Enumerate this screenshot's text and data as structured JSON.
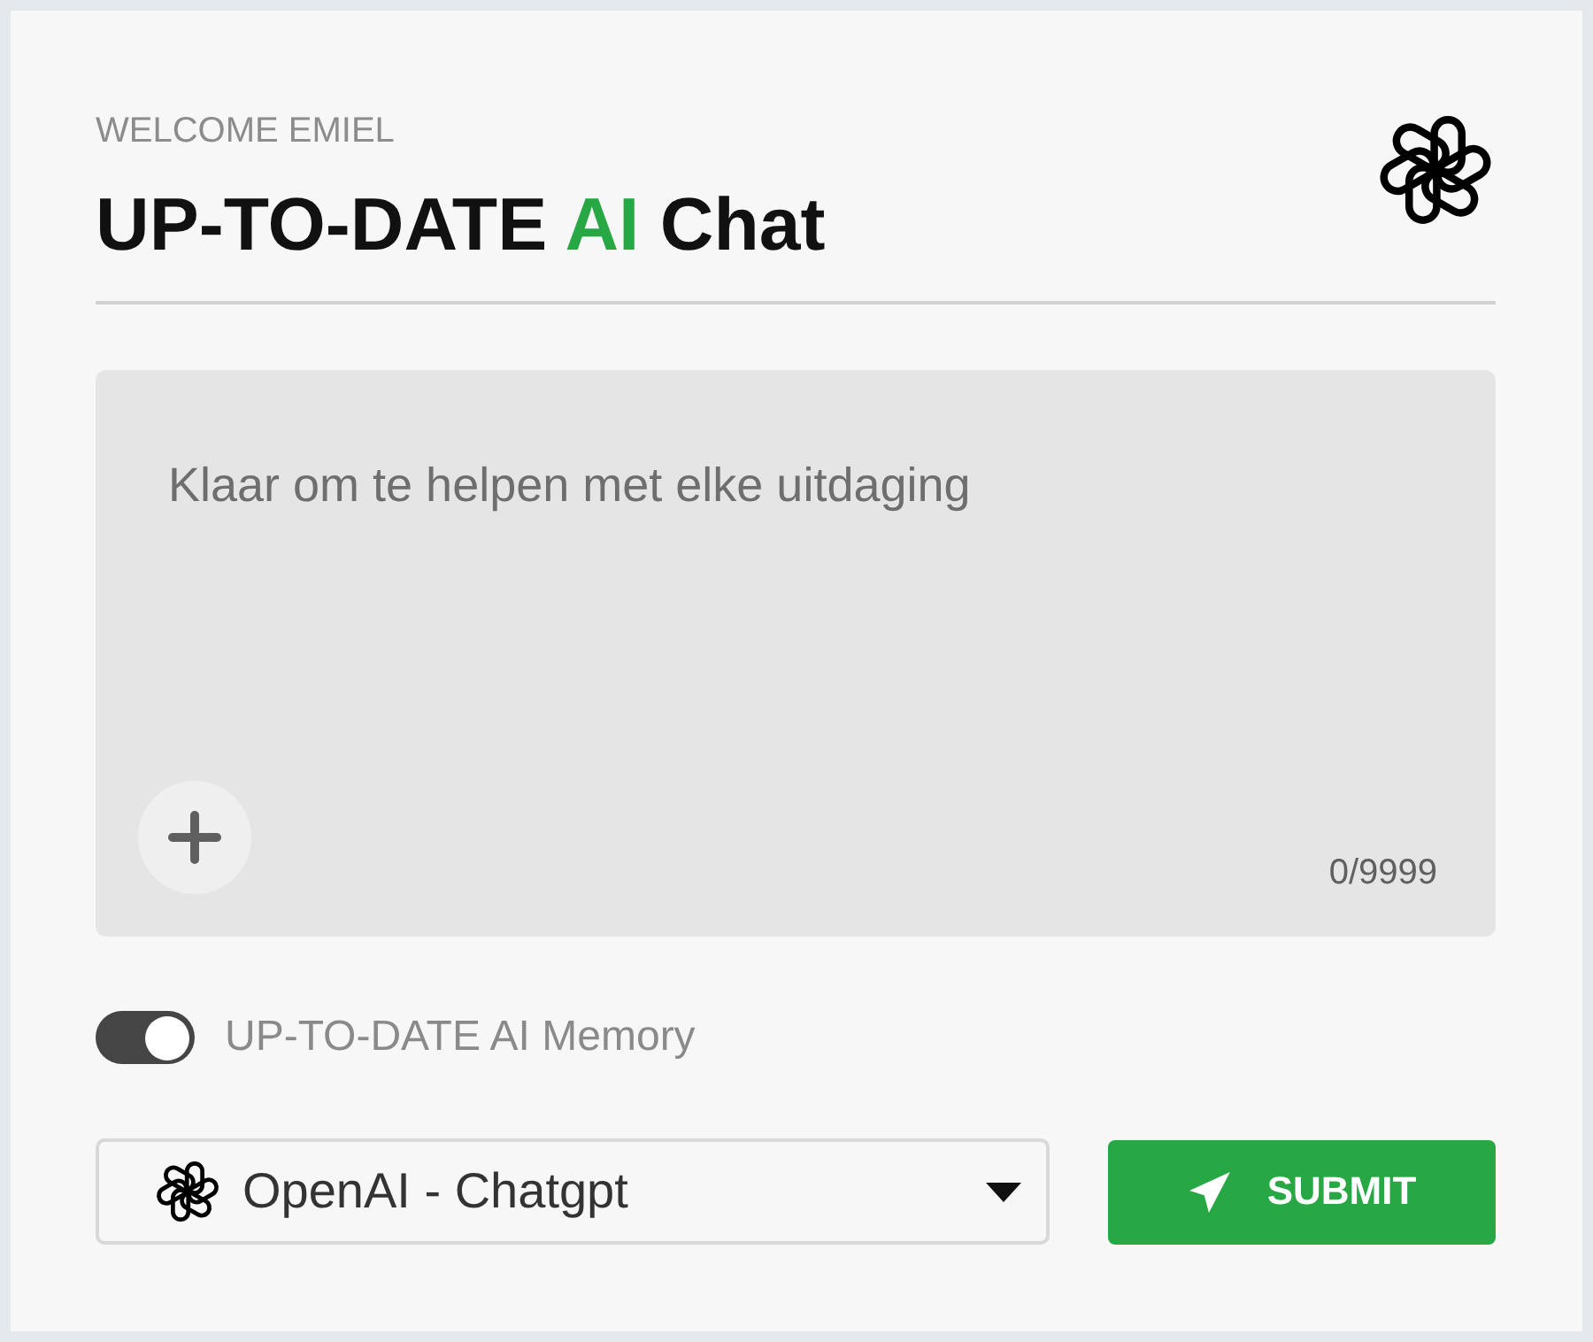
{
  "header": {
    "greeting": "WELCOME EMIEL",
    "title": [
      {
        "text": "UP-TO-DATE ",
        "accent": false
      },
      {
        "text": "AI",
        "accent": true
      },
      {
        "text": " Chat",
        "accent": false
      }
    ]
  },
  "prompt": {
    "placeholder": "Klaar om te helpen met elke uitdaging",
    "counter": "0/9999"
  },
  "memory_toggle": {
    "label": "UP-TO-DATE AI Memory",
    "on": true
  },
  "model_select": {
    "value": "OpenAI - Chatgpt"
  },
  "submit_button": {
    "label": "SUBMIT"
  }
}
